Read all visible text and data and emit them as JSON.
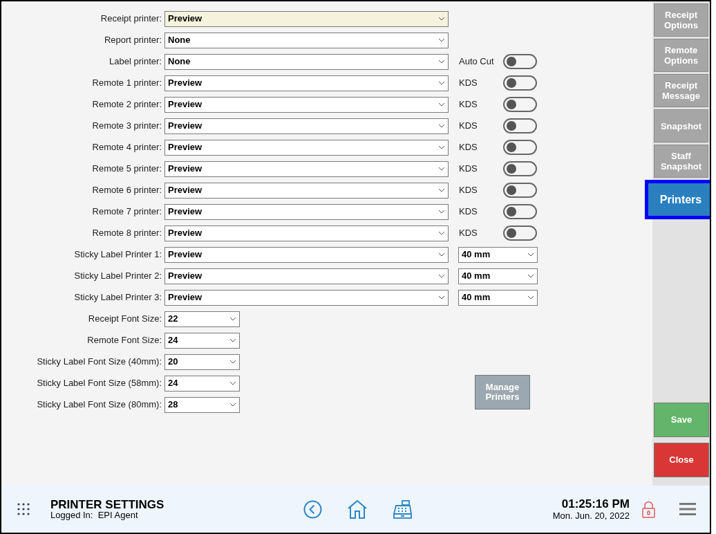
{
  "printer_rows": [
    {
      "label": "Receipt printer:",
      "value": "Preview",
      "highlighted": true
    },
    {
      "label": "Report printer:",
      "value": "None",
      "highlighted": false
    },
    {
      "label": "Label printer:",
      "value": "None",
      "highlighted": false,
      "extra": {
        "kind": "toggle",
        "label": "Auto Cut",
        "on": false
      }
    },
    {
      "label": "Remote 1 printer:",
      "value": "Preview",
      "highlighted": false,
      "extra": {
        "kind": "toggle",
        "label": "KDS",
        "on": false
      }
    },
    {
      "label": "Remote 2 printer:",
      "value": "Preview",
      "highlighted": false,
      "extra": {
        "kind": "toggle",
        "label": "KDS",
        "on": false
      }
    },
    {
      "label": "Remote 3 printer:",
      "value": "Preview",
      "highlighted": false,
      "extra": {
        "kind": "toggle",
        "label": "KDS",
        "on": false
      }
    },
    {
      "label": "Remote 4 printer:",
      "value": "Preview",
      "highlighted": false,
      "extra": {
        "kind": "toggle",
        "label": "KDS",
        "on": false
      }
    },
    {
      "label": "Remote 5 printer:",
      "value": "Preview",
      "highlighted": false,
      "extra": {
        "kind": "toggle",
        "label": "KDS",
        "on": false
      }
    },
    {
      "label": "Remote 6 printer:",
      "value": "Preview",
      "highlighted": false,
      "extra": {
        "kind": "toggle",
        "label": "KDS",
        "on": false
      }
    },
    {
      "label": "Remote 7 printer:",
      "value": "Preview",
      "highlighted": false,
      "extra": {
        "kind": "toggle",
        "label": "KDS",
        "on": false
      }
    },
    {
      "label": "Remote 8 printer:",
      "value": "Preview",
      "highlighted": false,
      "extra": {
        "kind": "toggle",
        "label": "KDS",
        "on": false
      }
    },
    {
      "label": "Sticky Label Printer 1:",
      "value": "Preview",
      "highlighted": false,
      "extra": {
        "kind": "select",
        "value": "40 mm"
      }
    },
    {
      "label": "Sticky Label Printer 2:",
      "value": "Preview",
      "highlighted": false,
      "extra": {
        "kind": "select",
        "value": "40 mm"
      }
    },
    {
      "label": "Sticky Label Printer 3:",
      "value": "Preview",
      "highlighted": false,
      "extra": {
        "kind": "select",
        "value": "40 mm"
      }
    }
  ],
  "font_rows": [
    {
      "label": "Receipt Font Size:",
      "value": "22"
    },
    {
      "label": "Remote Font Size:",
      "value": "24"
    },
    {
      "label": "Sticky Label Font Size (40mm):",
      "value": "20"
    },
    {
      "label": "Sticky Label Font Size (58mm):",
      "value": "24"
    },
    {
      "label": "Sticky Label Font Size (80mm):",
      "value": "28"
    }
  ],
  "manage_button": "Manage Printers",
  "sidebar": {
    "tabs": [
      {
        "label": "Receipt Options",
        "selected": false
      },
      {
        "label": "Remote Options",
        "selected": false
      },
      {
        "label": "Receipt Message",
        "selected": false
      },
      {
        "label": "Snapshot",
        "selected": false
      },
      {
        "label": "Staff Snapshot",
        "selected": false
      },
      {
        "label": "Printers",
        "selected": true
      }
    ],
    "save": "Save",
    "close": "Close"
  },
  "footer": {
    "title": "PRINTER SETTINGS",
    "logged_in_label": "Logged In:",
    "user": "EPI Agent",
    "time": "01:25:16 PM",
    "date": "Mon. Jun. 20, 2022"
  }
}
